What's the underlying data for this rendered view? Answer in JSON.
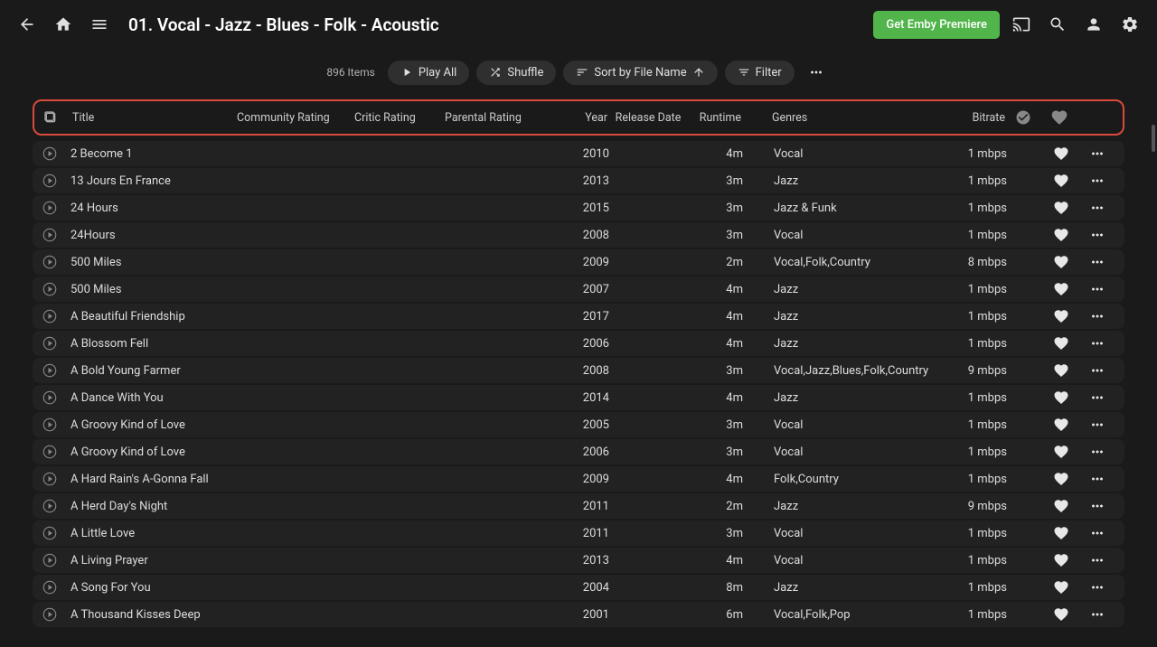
{
  "header": {
    "title": "01. Vocal - Jazz - Blues - Folk - Acoustic",
    "premiere_label": "Get Emby Premiere"
  },
  "toolbar": {
    "item_count": "896 Items",
    "play_all": "Play All",
    "shuffle": "Shuffle",
    "sort": "Sort by File Name",
    "filter": "Filter"
  },
  "columns": {
    "title": "Title",
    "community_rating": "Community Rating",
    "critic_rating": "Critic Rating",
    "parental_rating": "Parental Rating",
    "year": "Year",
    "release_date": "Release Date",
    "runtime": "Runtime",
    "genres": "Genres",
    "bitrate": "Bitrate"
  },
  "tracks": [
    {
      "title": "2 Become 1",
      "year": "2010",
      "runtime": "4m",
      "genres": "Vocal",
      "bitrate": "1 mbps"
    },
    {
      "title": "13 Jours En France",
      "year": "2013",
      "runtime": "3m",
      "genres": "Jazz",
      "bitrate": "1 mbps"
    },
    {
      "title": "24 Hours",
      "year": "2015",
      "runtime": "3m",
      "genres": "Jazz & Funk",
      "bitrate": "1 mbps"
    },
    {
      "title": "24Hours",
      "year": "2008",
      "runtime": "3m",
      "genres": "Vocal",
      "bitrate": "1 mbps"
    },
    {
      "title": "500 Miles",
      "year": "2009",
      "runtime": "2m",
      "genres": "Vocal,Folk,Country",
      "bitrate": "8 mbps"
    },
    {
      "title": "500 Miles",
      "year": "2007",
      "runtime": "4m",
      "genres": "Jazz",
      "bitrate": "1 mbps"
    },
    {
      "title": "A Beautiful Friendship",
      "year": "2017",
      "runtime": "4m",
      "genres": "Jazz",
      "bitrate": "1 mbps"
    },
    {
      "title": "A Blossom Fell",
      "year": "2006",
      "runtime": "4m",
      "genres": "Jazz",
      "bitrate": "1 mbps"
    },
    {
      "title": "A Bold Young Farmer",
      "year": "2008",
      "runtime": "3m",
      "genres": "Vocal,Jazz,Blues,Folk,Country",
      "bitrate": "9 mbps"
    },
    {
      "title": "A Dance With You",
      "year": "2014",
      "runtime": "4m",
      "genres": "Jazz",
      "bitrate": "1 mbps"
    },
    {
      "title": "A Groovy Kind of Love",
      "year": "2005",
      "runtime": "3m",
      "genres": "Vocal",
      "bitrate": "1 mbps"
    },
    {
      "title": "A Groovy Kind of Love",
      "year": "2006",
      "runtime": "3m",
      "genres": "Vocal",
      "bitrate": "1 mbps"
    },
    {
      "title": "A Hard Rain's A-Gonna Fall",
      "year": "2009",
      "runtime": "4m",
      "genres": "Folk,Country",
      "bitrate": "1 mbps"
    },
    {
      "title": "A Herd Day's Night",
      "year": "2011",
      "runtime": "2m",
      "genres": "Jazz",
      "bitrate": "9 mbps"
    },
    {
      "title": "A Little Love",
      "year": "2011",
      "runtime": "3m",
      "genres": "Vocal",
      "bitrate": "1 mbps"
    },
    {
      "title": "A Living Prayer",
      "year": "2013",
      "runtime": "4m",
      "genres": "Vocal",
      "bitrate": "1 mbps"
    },
    {
      "title": "A Song For You",
      "year": "2004",
      "runtime": "8m",
      "genres": "Jazz",
      "bitrate": "1 mbps"
    },
    {
      "title": "A Thousand Kisses Deep",
      "year": "2001",
      "runtime": "6m",
      "genres": "Vocal,Folk,Pop",
      "bitrate": "1 mbps"
    }
  ]
}
